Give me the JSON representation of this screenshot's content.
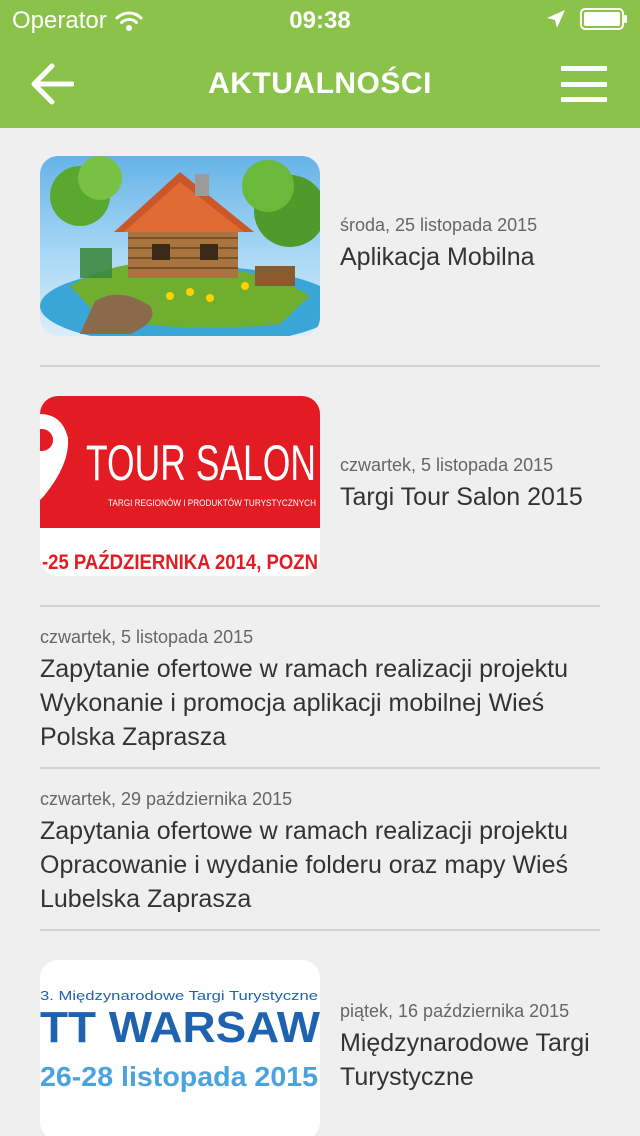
{
  "status_bar": {
    "carrier": "Operator",
    "time": "09:38"
  },
  "nav": {
    "title": "AKTUALNOŚCI"
  },
  "news": [
    {
      "date": "środa, 25 listopada 2015",
      "title": "Aplikacja Mobilna",
      "image": "cottage-illustration"
    },
    {
      "date": "czwartek, 5 listopada 2015",
      "title": "Targi Tour Salon 2015",
      "image": "tour-salon-banner",
      "image_text": {
        "brand": "TOUR SALON",
        "tagline": "TARGI REGIONÓW I PRODUKTÓW TURYSTYCZNYCH",
        "dates": "-25 PAŹDZIERNIKA 2014, POZN"
      }
    },
    {
      "date": "czwartek, 5 listopada 2015",
      "title": "Zapytanie ofertowe w ramach realizacji projektu Wykonanie i promocja aplikacji mobilnej Wieś Polska Zaprasza"
    },
    {
      "date": "czwartek, 29 października 2015",
      "title": "Zapytania ofertowe w ramach realizacji projektu Opracowanie i wydanie folderu oraz mapy Wieś Lubelska Zaprasza"
    },
    {
      "date": "piątek, 16 października 2015",
      "title": "Międzynarodowe Targi Turystyczne",
      "image": "tt-warsaw-banner",
      "image_text": {
        "top": "3. Międzynarodowe Targi Turystyczne",
        "brand": "TT WARSAW",
        "dates": "26-28 listopada 2015"
      }
    }
  ],
  "colors": {
    "accent": "#8bc34a",
    "background": "#efefef",
    "tour_red": "#e31b23",
    "warsaw_blue": "#1f63b0"
  }
}
